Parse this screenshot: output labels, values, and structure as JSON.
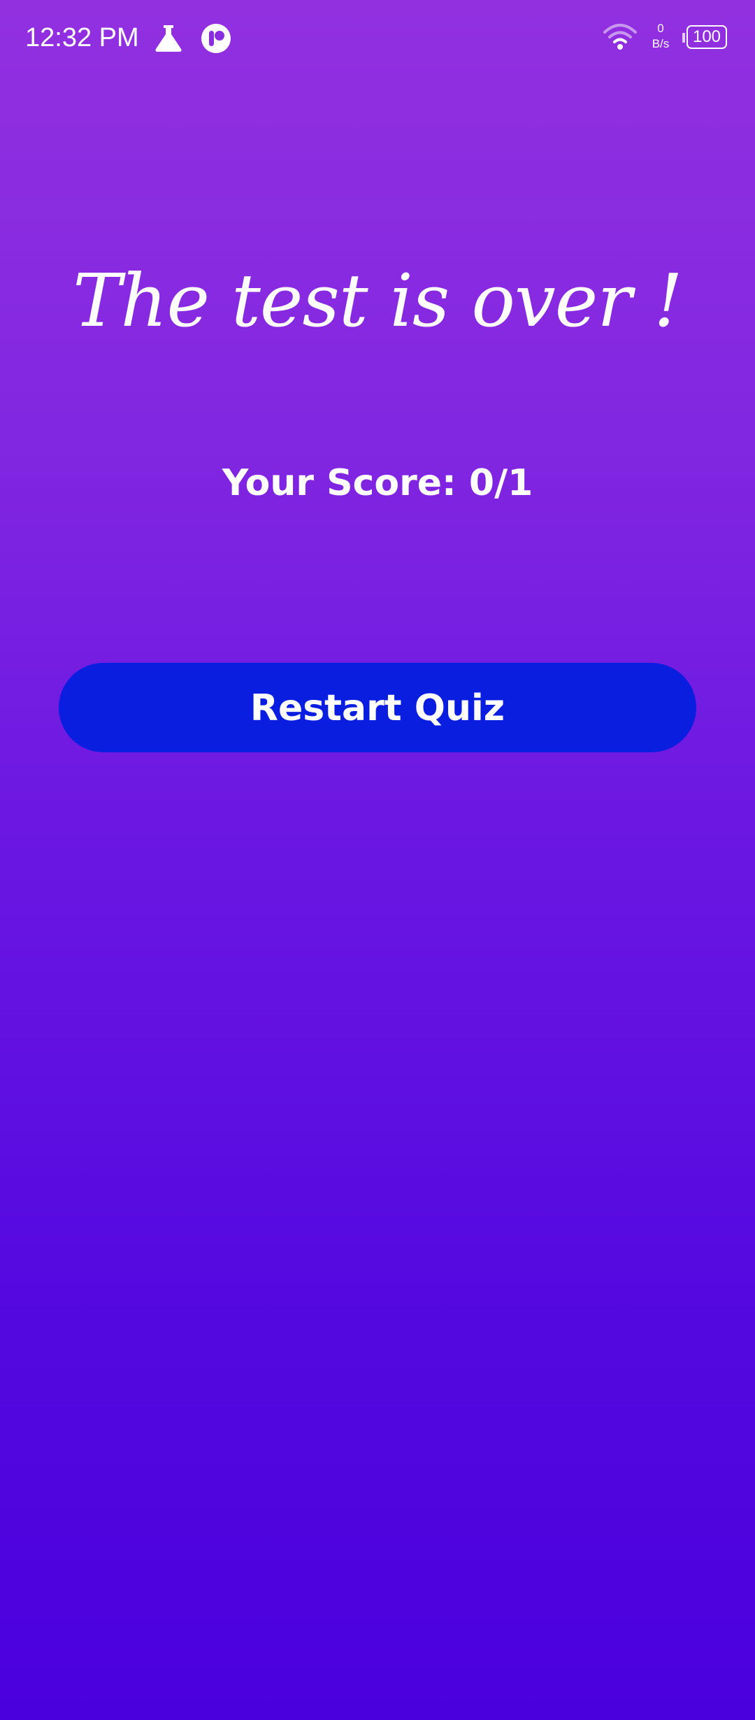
{
  "status_bar": {
    "time": "12:32 PM",
    "netspeed_value": "0",
    "netspeed_unit": "B/s",
    "battery_level": "100",
    "icons": [
      "flask-icon",
      "app-icon",
      "wifi-icon",
      "battery-icon"
    ]
  },
  "screen": {
    "title": "The test is over !",
    "score_text": "Your Score: 0/1",
    "restart_label": "Restart Quiz"
  },
  "colors": {
    "background_top": "#9230e0",
    "background_bottom": "#4a00dd",
    "button": "#0a1ee0",
    "text": "#ffffff"
  }
}
